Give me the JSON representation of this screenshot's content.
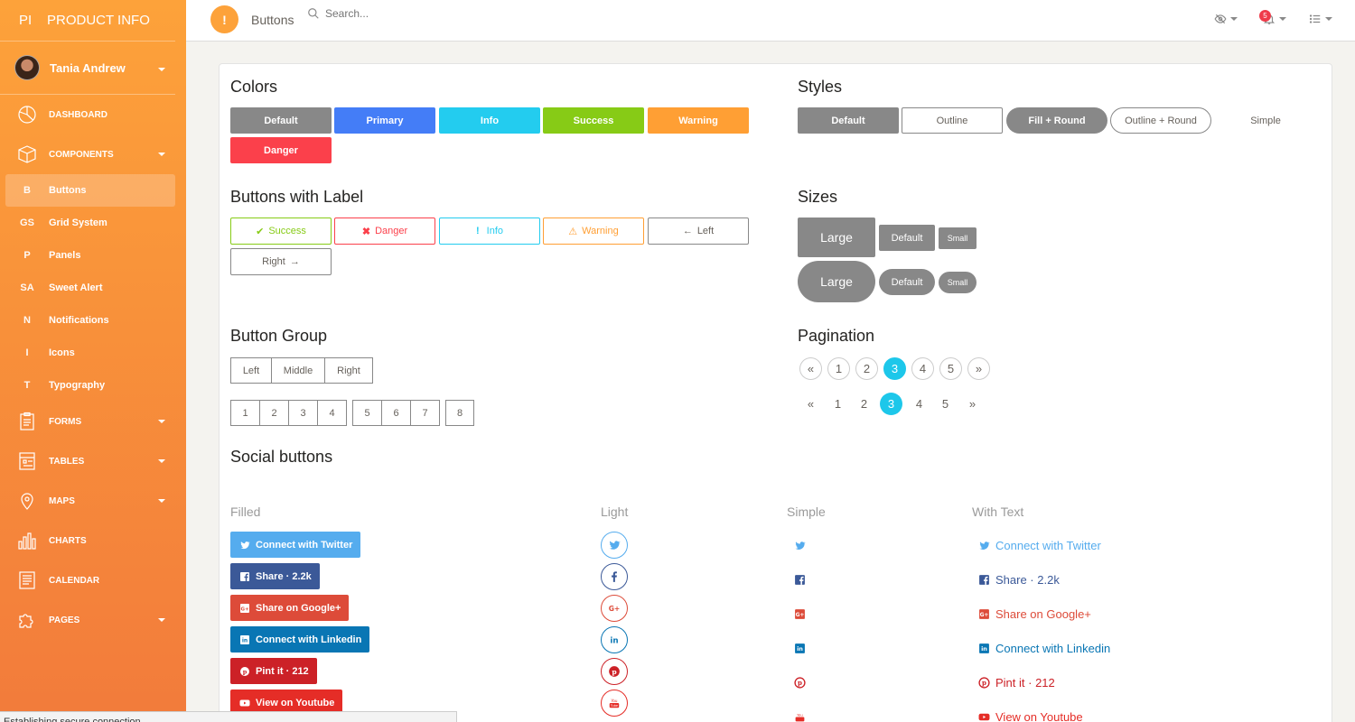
{
  "brand": {
    "mini": "PI",
    "name": "PRODUCT INFO"
  },
  "user": {
    "name": "Tania Andrew"
  },
  "nav": {
    "dashboard": "DASHBOARD",
    "components": "COMPONENTS",
    "sub": [
      {
        "abbr": "B",
        "label": "Buttons"
      },
      {
        "abbr": "GS",
        "label": "Grid System"
      },
      {
        "abbr": "P",
        "label": "Panels"
      },
      {
        "abbr": "SA",
        "label": "Sweet Alert"
      },
      {
        "abbr": "N",
        "label": "Notifications"
      },
      {
        "abbr": "I",
        "label": "Icons"
      },
      {
        "abbr": "T",
        "label": "Typography"
      }
    ],
    "forms": "FORMS",
    "tables": "TABLES",
    "maps": "MAPS",
    "charts": "CHARTS",
    "calendar": "CALENDAR",
    "pages": "PAGES"
  },
  "topbar": {
    "icon": "!",
    "title": "Buttons",
    "search_placeholder": "Search...",
    "notifications": "5"
  },
  "colors_section": {
    "title": "Colors",
    "buttons": [
      {
        "label": "Default",
        "color": "#888888"
      },
      {
        "label": "Primary",
        "color": "#447df7"
      },
      {
        "label": "Info",
        "color": "#23ccef"
      },
      {
        "label": "Success",
        "color": "#87cb16"
      },
      {
        "label": "Warning",
        "color": "#ff9f34"
      },
      {
        "label": "Danger",
        "color": "#fb404b"
      }
    ]
  },
  "styles_section": {
    "title": "Styles",
    "default": "Default",
    "outline": "Outline",
    "fill_round": "Fill + Round",
    "outline_round": "Outline + Round",
    "simple": "Simple"
  },
  "label_section": {
    "title": "Buttons with Label",
    "success": "Success",
    "danger": "Danger",
    "info": "Info",
    "warning": "Warning",
    "left": "Left",
    "right": "Right"
  },
  "sizes_section": {
    "title": "Sizes",
    "large": "Large",
    "default": "Default",
    "small": "Small"
  },
  "group_section": {
    "title": "Button Group",
    "group1": [
      "Left",
      "Middle",
      "Right"
    ],
    "group2": [
      "1",
      "2",
      "3",
      "4"
    ],
    "group3": [
      "5",
      "6",
      "7"
    ],
    "group4": [
      "8"
    ]
  },
  "pagination_section": {
    "title": "Pagination",
    "prev": "«",
    "next": "»",
    "pages": [
      "1",
      "2",
      "3",
      "4",
      "5"
    ],
    "active": "3"
  },
  "social": {
    "title": "Social buttons",
    "col_filled": "Filled",
    "col_light": "Light",
    "col_simple": "Simple",
    "col_text": "With Text",
    "twitter": "Connect with Twitter",
    "facebook": "Share · 2.2k",
    "google": "Share on Google+",
    "linkedin": "Connect with Linkedin",
    "pinterest": "Pint it · 212",
    "youtube": "View on Youtube",
    "colors": {
      "twitter": "#55acee",
      "facebook": "#3b5998",
      "google": "#dd4b39",
      "linkedin": "#0976b4",
      "pinterest": "#cc2127",
      "youtube": "#e52d27"
    }
  },
  "statusbar": {
    "text": "Establishing secure connection..."
  }
}
